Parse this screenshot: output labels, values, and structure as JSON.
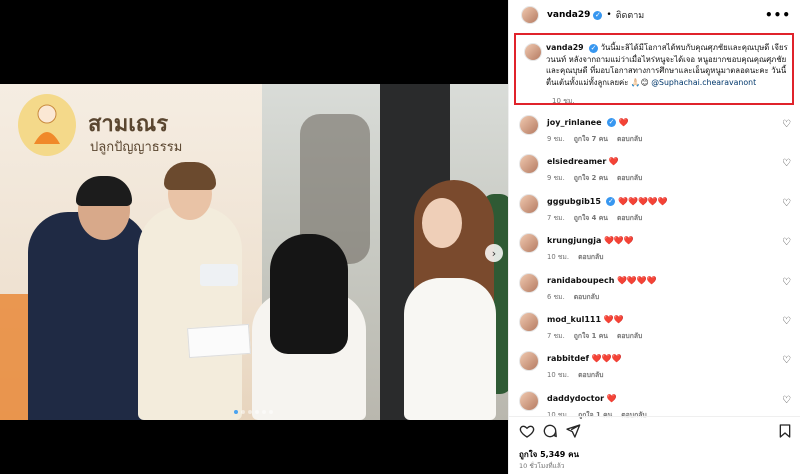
{
  "header": {
    "username": "vanda29",
    "dot": "•",
    "follow_label": "ติดตาม",
    "more": "•••"
  },
  "caption": {
    "username": "vanda29",
    "text": "วันนี้มะลิได้มีโอกาสได้พบกับคุณศุภชัยและคุณบุษดี เจียรวนนท์ หลังจากถามแม่ว่าเมื่อไหร่หนูจะได้เจอ หนูอยากขอบคุณคุณศุภชัยและคุณบุษดี ที่มอบโอกาสทางการศึกษาและเอ็นดูหนูมาตลอดนะคะ วันนี้ตื่นเต้นทั้งแม่ทั้งลูกเลยค่ะ 🙏🏻😊",
    "mention": "@Suphachai.chearavanont",
    "time": "10 ชม."
  },
  "image": {
    "logo_title": "สามเณร",
    "logo_sub": "ปลูกปัญญาธรรม",
    "slide_count": 6,
    "active_slide": 1
  },
  "comments": [
    {
      "user": "joy_rinlanee",
      "text": "❤️",
      "time": "9 ชม.",
      "likes": "ถูกใจ 7 คน",
      "reply": "ตอบกลับ",
      "verified": true
    },
    {
      "user": "elsiedreamer",
      "text": "❤️",
      "time": "9 ชม.",
      "likes": "ถูกใจ 2 คน",
      "reply": "ตอบกลับ",
      "verified": false
    },
    {
      "user": "gggubgib15",
      "text": "❤️❤️❤️❤️❤️",
      "time": "7 ชม.",
      "likes": "ถูกใจ 4 คน",
      "reply": "ตอบกลับ",
      "verified": true
    },
    {
      "user": "krungjungja",
      "text": "❤️❤️❤️",
      "time": "10 ชม.",
      "likes": "",
      "reply": "ตอบกลับ",
      "verified": false
    },
    {
      "user": "ranidaboupech",
      "text": "❤️❤️❤️❤️",
      "time": "6 ชม.",
      "likes": "",
      "reply": "ตอบกลับ",
      "verified": false
    },
    {
      "user": "mod_kul111",
      "text": "❤️❤️",
      "time": "7 ชม.",
      "likes": "ถูกใจ 1 คน",
      "reply": "ตอบกลับ",
      "verified": false
    },
    {
      "user": "rabbitdef",
      "text": "❤️❤️❤️",
      "time": "10 ชม.",
      "likes": "",
      "reply": "ตอบกลับ",
      "verified": false
    },
    {
      "user": "daddydoctor",
      "text": "❤️",
      "time": "10 ชม.",
      "likes": "ถูกใจ 1 คน",
      "reply": "ตอบกลับ",
      "verified": false
    }
  ],
  "footer": {
    "likes": "ถูกใจ 5,349 คน",
    "posted": "10 ชั่วโมงที่แล้ว"
  },
  "colors": {
    "highlight_border": "#e0232b",
    "verified": "#3897f0",
    "heart": "#ed2e58"
  }
}
